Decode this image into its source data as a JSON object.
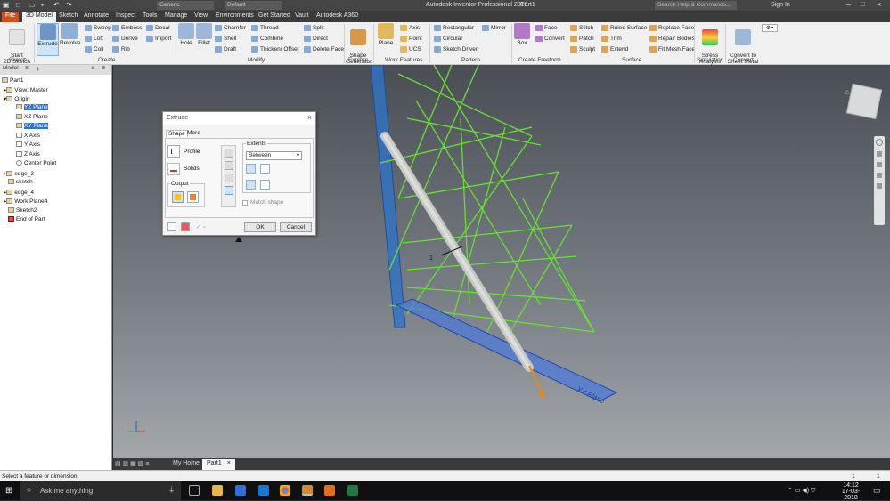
{
  "app": {
    "title": "Autodesk Inventor Professional 2018",
    "doc_name": "Part1",
    "style_dropdown": "Generic",
    "appearance_dropdown": "Default",
    "search_placeholder": "Search Help & Commands...",
    "sign_in": "Sign In"
  },
  "tabs": [
    "File",
    "3D Model",
    "Sketch",
    "Annotate",
    "Inspect",
    "Tools",
    "Manage",
    "View",
    "Environments",
    "Get Started",
    "Vault",
    "Autodesk A360"
  ],
  "ribbon": {
    "sketch": {
      "start_2d_sketch": "Start\n2D Sketch",
      "panel": "Sketch"
    },
    "create": {
      "extrude": "Extrude",
      "revolve": "Revolve",
      "sweep": "Sweep",
      "loft": "Loft",
      "coil": "Coil",
      "emboss": "Emboss",
      "derive": "Derive",
      "rib": "Rib",
      "decal": "Decal",
      "import": "Import",
      "panel": "Create"
    },
    "modify": {
      "hole": "Hole",
      "fillet": "Fillet",
      "chamfer": "Chamfer",
      "shell": "Shell",
      "draft": "Draft",
      "thread": "Thread",
      "combine": "Combine",
      "thicken": "Thicken/ Offset",
      "split": "Split",
      "direct": "Direct",
      "delete_face": "Delete Face",
      "panel": "Modify"
    },
    "explore": {
      "shape_generator": "Shape\nGenerator",
      "panel": "Explore"
    },
    "work_features": {
      "plane": "Plane",
      "axis": "Axis",
      "point": "Point",
      "ucs": "UCS",
      "panel": "Work Features"
    },
    "pattern": {
      "rectangular": "Rectangular",
      "circular": "Circular",
      "sketch_driven": "Sketch Driven",
      "mirror": "Mirror",
      "panel": "Pattern"
    },
    "create_freeform": {
      "box": "Box",
      "face": "Face",
      "convert": "Convert",
      "panel": "Create Freeform"
    },
    "surface": {
      "stitch": "Stitch",
      "patch": "Patch",
      "sculpt": "Sculpt",
      "ruled_surface": "Ruled Surface",
      "trim": "Trim",
      "extend": "Extend",
      "replace_face": "Replace Face",
      "repair_bodies": "Repair Bodies",
      "fit_mesh_face": "Fit Mesh Face",
      "panel": "Surface"
    },
    "simulation": {
      "stress_analysis": "Stress\nAnalysis",
      "panel": "Simulation"
    },
    "convert": {
      "convert_sheet_metal": "Convert to\nSheet Metal",
      "panel": "Convert"
    }
  },
  "browser": {
    "header": "Model",
    "items": [
      {
        "label": "Part1",
        "selected": false
      },
      {
        "label": "View: Master",
        "selected": false
      },
      {
        "label": "Origin",
        "selected": false
      },
      {
        "label": "YZ Plane",
        "selected": true
      },
      {
        "label": "XZ Plane",
        "selected": false
      },
      {
        "label": "XY Plane",
        "selected": true
      },
      {
        "label": "X Axis",
        "selected": false
      },
      {
        "label": "Y Axis",
        "selected": false
      },
      {
        "label": "Z Axis",
        "selected": false
      },
      {
        "label": "Center Point",
        "selected": false
      },
      {
        "label": "edge_3",
        "selected": false
      },
      {
        "label": "sketch",
        "selected": false
      },
      {
        "label": "edge_4",
        "selected": false
      },
      {
        "label": "Work Plane4",
        "selected": false
      },
      {
        "label": "Sketch2",
        "selected": false
      },
      {
        "label": "End of Part",
        "selected": false
      }
    ]
  },
  "dialog": {
    "title": "Extrude",
    "tab_shape": "Shape",
    "tab_more": "More",
    "profile": "Profile",
    "solids": "Solids",
    "output": "Output",
    "extents": "Extents",
    "extents_value": "Between",
    "match_shape": "Match shape",
    "ok": "OK",
    "cancel": "Cancel"
  },
  "viewport": {
    "plane_label": "XY Plane",
    "dimension_label": "1"
  },
  "doc_tabs": {
    "my_home": "My Home",
    "part1": "Part1"
  },
  "status": {
    "message": "Select a feature or dimension",
    "count1": "1",
    "count2": "1"
  },
  "taskbar": {
    "search": "Ask me anything",
    "time": "14:12",
    "date": "17-03-2018"
  },
  "colors": {
    "accent": "#d24f1d",
    "sketch_green": "#66e032",
    "plane_blue": "#2d6fd3",
    "selection": "#2f6fd8"
  }
}
